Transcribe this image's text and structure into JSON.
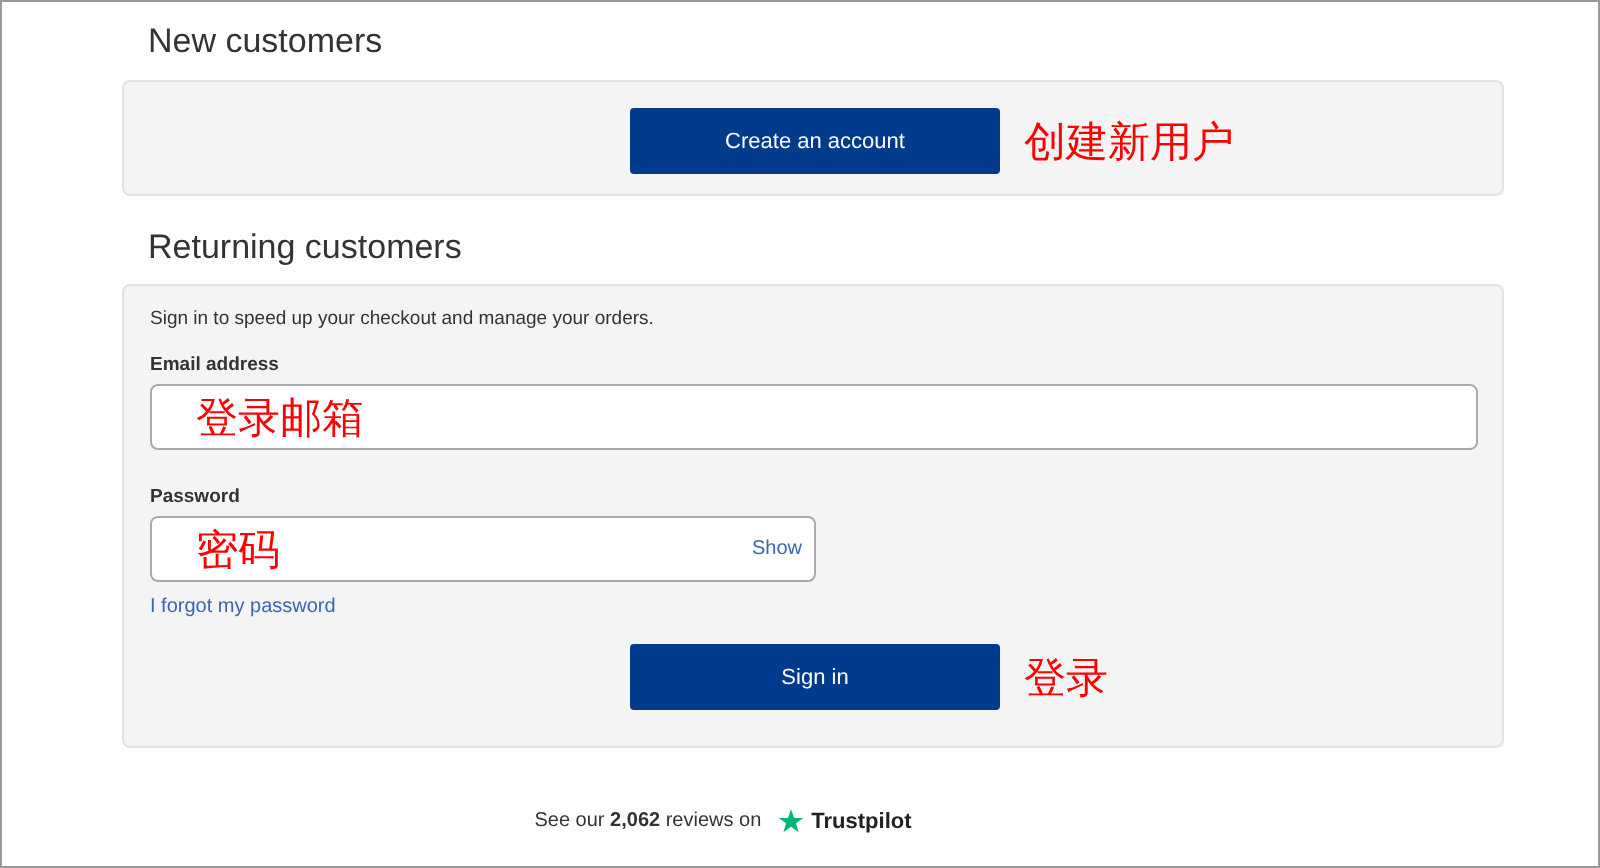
{
  "new_customers": {
    "heading": "New customers",
    "button": "Create an account",
    "annotation": "创建新用户"
  },
  "returning_customers": {
    "heading": "Returning customers",
    "intro": "Sign in to speed up your checkout and manage your orders.",
    "email": {
      "label": "Email address",
      "annotation": "登录邮箱"
    },
    "password": {
      "label": "Password",
      "annotation": "密码",
      "toggle": "Show"
    },
    "forgot_link": "I forgot my password",
    "button": "Sign in",
    "annotation": "登录"
  },
  "footer": {
    "text": "See our **2,062** reviews on",
    "brand": "Trustpilot"
  }
}
